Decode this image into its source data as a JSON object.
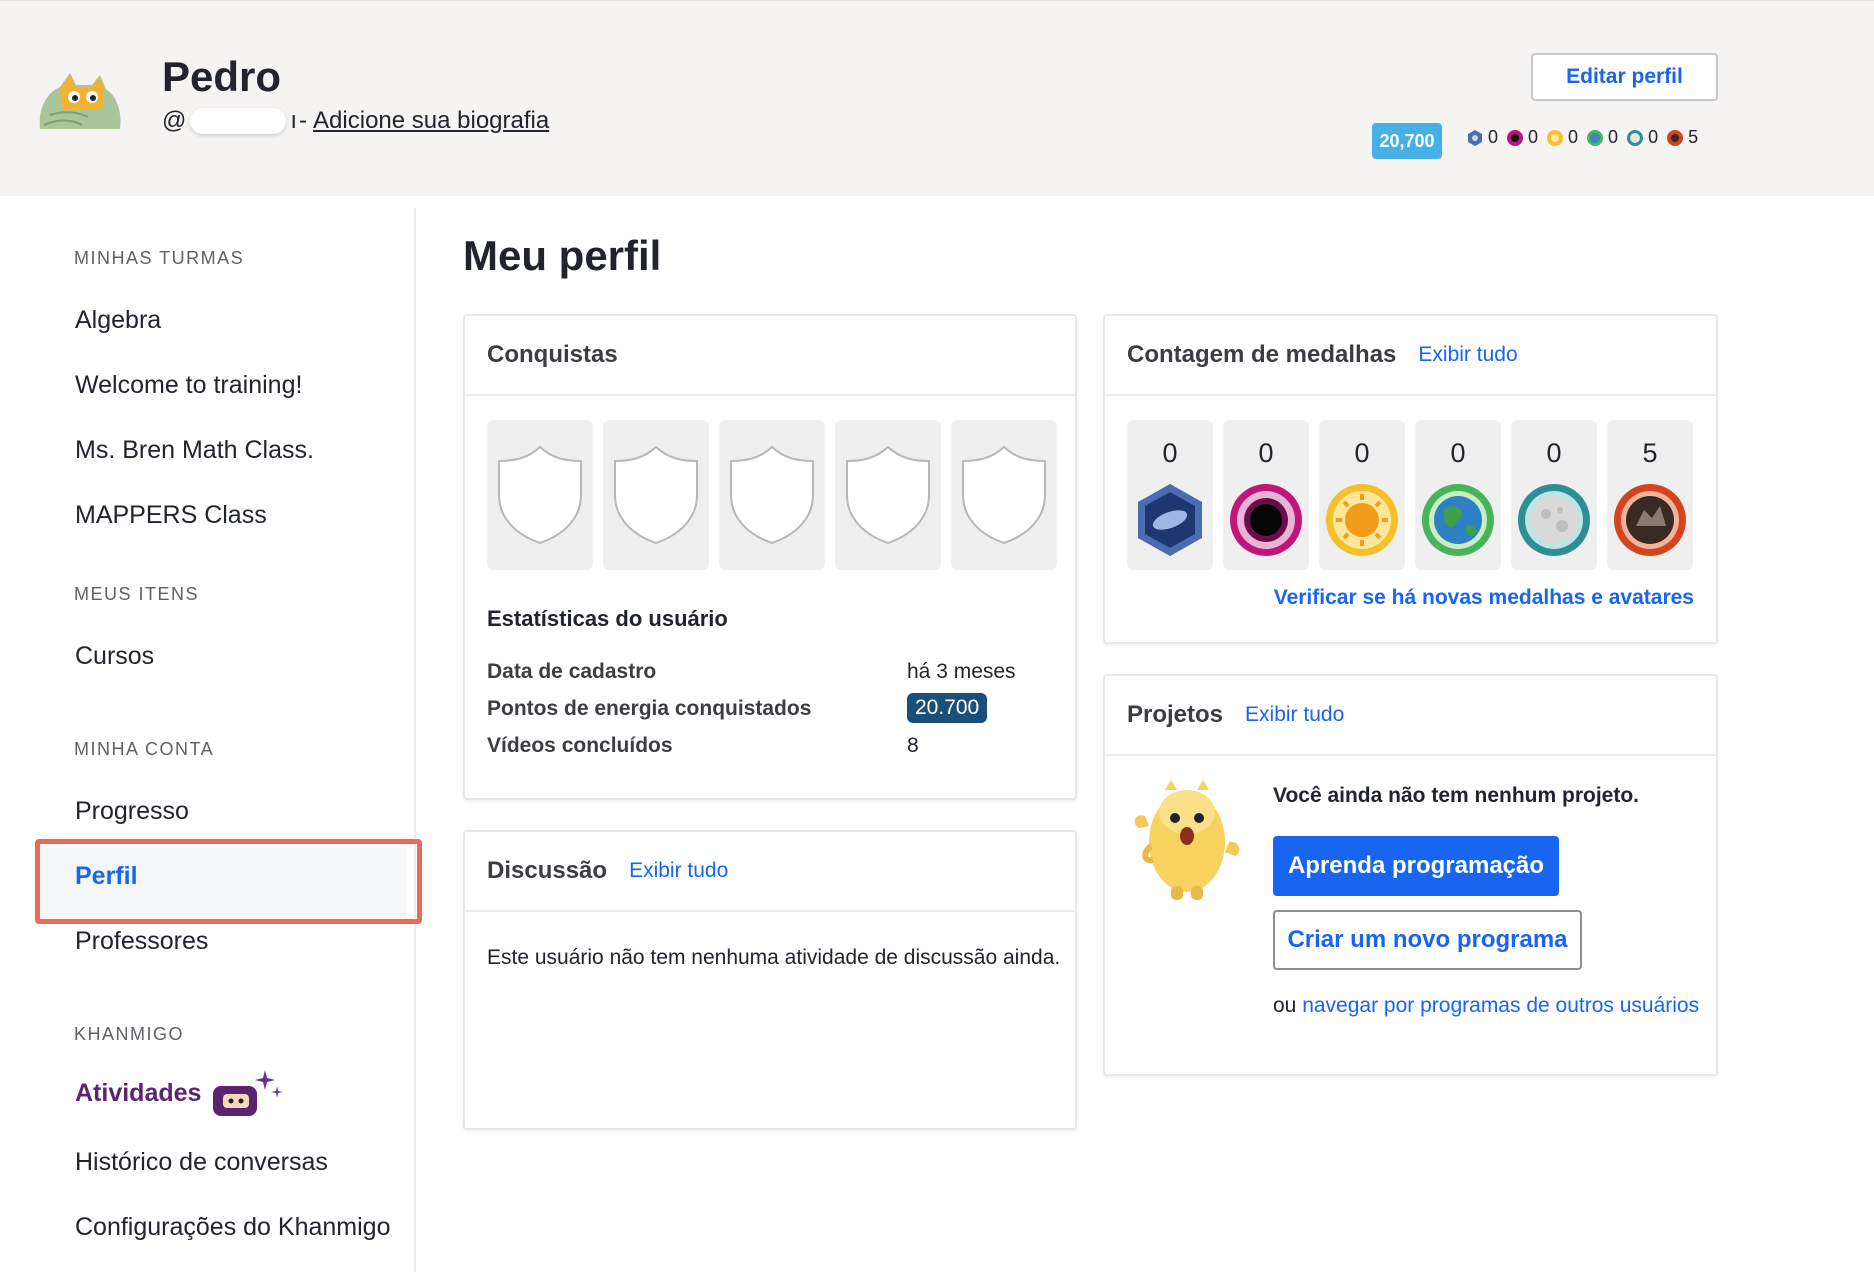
{
  "header": {
    "name": "Pedro",
    "handle_prefix": "@",
    "handle_suffix": "ı",
    "separator": "-",
    "bio_link": "Adicione sua biografia",
    "edit_button": "Editar perfil",
    "points": "20,700",
    "badge_counts": [
      {
        "icon": "meteorite-badge-icon",
        "count": "0",
        "color": "#4c6bb0"
      },
      {
        "icon": "black-hole-badge-icon",
        "count": "0",
        "color": "#c0157a"
      },
      {
        "icon": "sun-badge-icon",
        "count": "0",
        "color": "#f6c02b"
      },
      {
        "icon": "earth-badge-icon",
        "count": "0",
        "color": "#49b35a"
      },
      {
        "icon": "moon-badge-icon",
        "count": "0",
        "color": "#2e8d95"
      },
      {
        "icon": "challenge-patch-icon",
        "count": "5",
        "color": "#d4451f"
      }
    ]
  },
  "sidebar": {
    "section_classes": "MINHAS TURMAS",
    "classes": [
      "Algebra",
      "Welcome to training!",
      "Ms. Bren Math Class.",
      "MAPPERS Class"
    ],
    "section_items": "MEUS ITENS",
    "items": [
      "Cursos"
    ],
    "section_account": "MINHA CONTA",
    "account": [
      "Progresso",
      "Perfil",
      "Professores"
    ],
    "section_khanmigo": "KHANMIGO",
    "khanmigo": [
      "Atividades",
      "Histórico de conversas",
      "Configurações do Khanmigo"
    ],
    "active_item": "Perfil"
  },
  "main": {
    "title": "Meu perfil",
    "achievements": {
      "title": "Conquistas",
      "stats_title": "Estatísticas do usuário",
      "stats": [
        {
          "label": "Data de cadastro",
          "value": "há 3 meses"
        },
        {
          "label": "Pontos de energia conquistados",
          "value": "20.700"
        },
        {
          "label": "Vídeos concluídos",
          "value": "8"
        }
      ]
    },
    "medals": {
      "title": "Contagem de medalhas",
      "view_all": "Exibir tudo",
      "counts": [
        "0",
        "0",
        "0",
        "0",
        "0",
        "5"
      ],
      "check_link": "Verificar se há novas medalhas e avatares"
    },
    "discussion": {
      "title": "Discussão",
      "view_all": "Exibir tudo",
      "empty_text": "Este usuário não tem nenhuma atividade de discussão ainda."
    },
    "projects": {
      "title": "Projetos",
      "view_all": "Exibir tudo",
      "empty_text": "Você ainda não tem nenhum projeto.",
      "learn_button": "Aprenda programação",
      "new_button": "Criar um novo programa",
      "or_text": "ou",
      "browse_link": "navegar por programas de outros usuários"
    }
  },
  "colors": {
    "accent": "#1865f2",
    "highlight": "#ea6b5a",
    "khanmigo": "#5b2470",
    "points_badge": "#46b1e4",
    "energy_badge": "#1b4f7a"
  }
}
